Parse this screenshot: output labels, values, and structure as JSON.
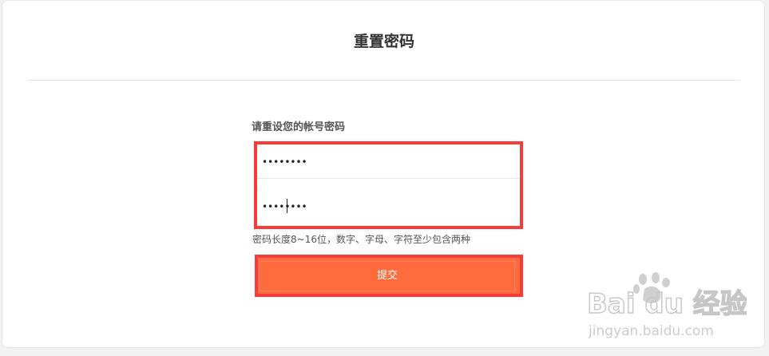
{
  "page": {
    "title": "重置密码"
  },
  "form": {
    "label": "请重设您的帐号密码",
    "password_value": "••••••••",
    "confirm_value": "••••••••",
    "hint": "密码长度8~16位，数字、字母、字符至少包含两种",
    "submit_label": "提交"
  },
  "colors": {
    "accent": "#ff6b3d",
    "highlight": "#f73b3b"
  },
  "watermark": {
    "brand": "Baidu经验",
    "url": "jingyan.baidu.com",
    "icon": "baidu-paw-icon"
  }
}
